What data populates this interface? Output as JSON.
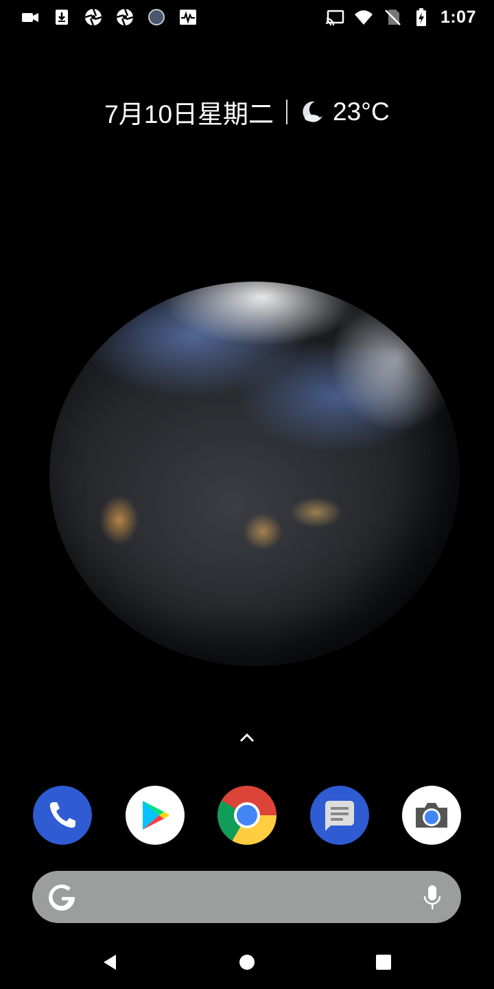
{
  "status_bar": {
    "left_icons": [
      "video-camera-icon",
      "download-icon",
      "aperture-icon",
      "aperture-icon",
      "circle-icon",
      "activity-icon"
    ],
    "right_icons": [
      "cast-icon",
      "wifi-icon",
      "no-sim-icon",
      "battery-charging-icon"
    ],
    "time": "1:07"
  },
  "glance": {
    "date": "7月10日星期二",
    "weather_icon": "moon-icon",
    "temperature": "23°C"
  },
  "wallpaper": "earth-at-night",
  "app_drawer_hint": "chevron-up-icon",
  "dock": {
    "apps": [
      {
        "name": "Phone",
        "icon": "phone-app-icon"
      },
      {
        "name": "Play Store",
        "icon": "play-store-icon"
      },
      {
        "name": "Chrome",
        "icon": "chrome-icon"
      },
      {
        "name": "Messages",
        "icon": "messages-app-icon"
      },
      {
        "name": "Camera",
        "icon": "camera-app-icon"
      }
    ]
  },
  "search_bar": {
    "logo": "google-g-icon",
    "mic": "microphone-icon",
    "background": "#9b9e9c"
  },
  "nav_bar": {
    "back": "back-icon",
    "home": "home-icon",
    "recents": "recents-icon"
  }
}
